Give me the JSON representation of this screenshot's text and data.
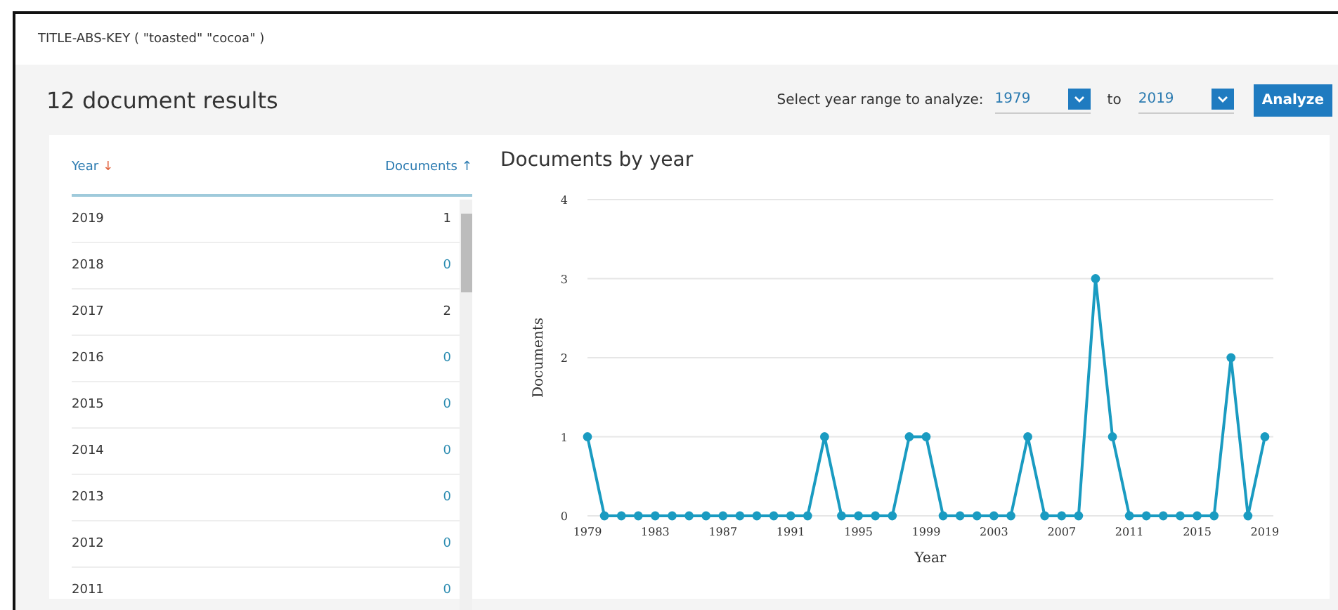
{
  "query": "TITLE-ABS-KEY ( \"toasted\"  \"cocoa\" )",
  "results_title": "12 document results",
  "year_range": {
    "label": "Select year range to analyze:",
    "from": "1979",
    "to_label": "to",
    "to": "2019",
    "button": "Analyze"
  },
  "table": {
    "columns": [
      {
        "label": "Year",
        "arrow": "↓",
        "selected": true
      },
      {
        "label": "Documents",
        "arrow": "↑",
        "selected": false
      }
    ],
    "rows": [
      {
        "year": "2019",
        "count": "1",
        "linked": false
      },
      {
        "year": "2018",
        "count": "0",
        "linked": true
      },
      {
        "year": "2017",
        "count": "2",
        "linked": false
      },
      {
        "year": "2016",
        "count": "0",
        "linked": true
      },
      {
        "year": "2015",
        "count": "0",
        "linked": true
      },
      {
        "year": "2014",
        "count": "0",
        "linked": true
      },
      {
        "year": "2013",
        "count": "0",
        "linked": true
      },
      {
        "year": "2012",
        "count": "0",
        "linked": true
      },
      {
        "year": "2011",
        "count": "0",
        "linked": true
      }
    ]
  },
  "chart": {
    "title": "Documents by year",
    "chart_data": {
      "type": "line",
      "xlabel": "Year",
      "ylabel": "Documents",
      "x": [
        1979,
        1980,
        1981,
        1982,
        1983,
        1984,
        1985,
        1986,
        1987,
        1988,
        1989,
        1990,
        1991,
        1992,
        1993,
        1994,
        1995,
        1996,
        1997,
        1998,
        1999,
        2000,
        2001,
        2002,
        2003,
        2004,
        2005,
        2006,
        2007,
        2008,
        2009,
        2010,
        2011,
        2012,
        2013,
        2014,
        2015,
        2016,
        2017,
        2018,
        2019
      ],
      "grid": true,
      "series": [
        {
          "color": "#1a9bc1",
          "marker": "circle",
          "values": [
            1,
            0,
            0,
            0,
            0,
            0,
            0,
            0,
            0,
            0,
            0,
            0,
            0,
            0,
            1,
            0,
            0,
            0,
            0,
            1,
            1,
            0,
            0,
            0,
            0,
            0,
            1,
            0,
            0,
            0,
            3,
            1,
            0,
            0,
            0,
            0,
            0,
            0,
            2,
            0,
            1
          ]
        }
      ],
      "xlim": [
        1979,
        2019.5
      ],
      "ylim": [
        0,
        4
      ],
      "xticks": [
        1979,
        1983,
        1987,
        1991,
        1995,
        1999,
        2003,
        2007,
        2011,
        2015,
        2019
      ],
      "yticks": [
        0,
        1,
        2,
        3,
        4
      ]
    }
  }
}
